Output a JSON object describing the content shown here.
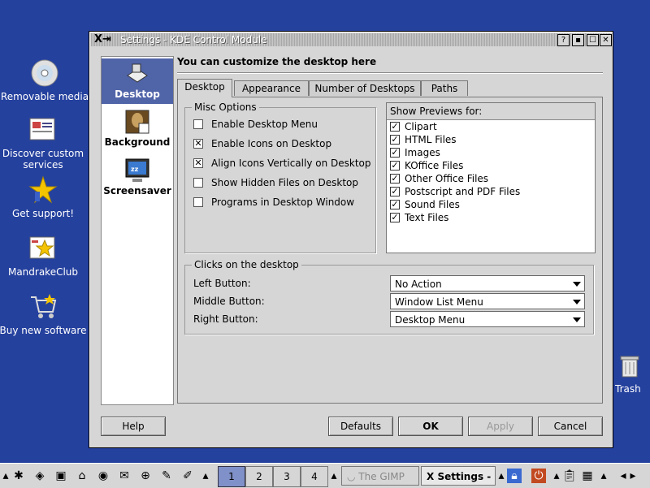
{
  "desktop": {
    "icons": [
      {
        "label": "Removable media",
        "icon": "cd-icon"
      },
      {
        "label": "Discover custom services",
        "icon": "services-icon"
      },
      {
        "label": "Get support!",
        "icon": "star-icon"
      },
      {
        "label": "MandrakeClub",
        "icon": "club-icon"
      },
      {
        "label": "Buy new software",
        "icon": "cart-icon"
      },
      {
        "label": "Trash",
        "icon": "trash-icon"
      }
    ]
  },
  "window": {
    "title": "Settings - KDE Control Module",
    "title_buttons": [
      "?",
      "▪",
      "☐",
      "✕"
    ],
    "heading": "You can customize the desktop here",
    "sidebar": [
      {
        "label": "Desktop",
        "icon": "desktop-icon",
        "active": true
      },
      {
        "label": "Background",
        "icon": "background-icon",
        "active": false
      },
      {
        "label": "Screensaver",
        "icon": "screensaver-icon",
        "active": false
      }
    ],
    "tabs": [
      {
        "label": "Desktop",
        "active": true
      },
      {
        "label": "Appearance",
        "active": false
      },
      {
        "label": "Number of Desktops",
        "active": false
      },
      {
        "label": "Paths",
        "active": false
      }
    ],
    "misc_options": {
      "title": "Misc Options",
      "items": [
        {
          "label": "Enable Desktop Menu",
          "checked": false
        },
        {
          "label": "Enable Icons on Desktop",
          "checked": true
        },
        {
          "label": "Align Icons Vertically on Desktop",
          "checked": true
        },
        {
          "label": "Show Hidden Files on Desktop",
          "checked": false
        },
        {
          "label": "Programs in Desktop Window",
          "checked": false
        }
      ]
    },
    "previews": {
      "header": "Show Previews for:",
      "items": [
        {
          "label": "Clipart",
          "checked": true
        },
        {
          "label": "HTML Files",
          "checked": true
        },
        {
          "label": "Images",
          "checked": true
        },
        {
          "label": "KOffice Files",
          "checked": true
        },
        {
          "label": "Other Office Files",
          "checked": true
        },
        {
          "label": "Postscript and PDF Files",
          "checked": true
        },
        {
          "label": "Sound Files",
          "checked": true
        },
        {
          "label": "Text Files",
          "checked": true
        }
      ]
    },
    "clicks": {
      "title": "Clicks on the desktop",
      "rows": [
        {
          "label": "Left Button:",
          "value": "No Action"
        },
        {
          "label": "Middle Button:",
          "value": "Window List Menu"
        },
        {
          "label": "Right Button:",
          "value": "Desktop Menu"
        }
      ]
    },
    "buttons": {
      "help": "Help",
      "defaults": "Defaults",
      "ok": "OK",
      "apply": "Apply",
      "cancel": "Cancel"
    }
  },
  "taskbar": {
    "desktops": [
      "1",
      "2",
      "3",
      "4"
    ],
    "tasks": [
      {
        "label": "The GIMP",
        "active": false
      },
      {
        "label": "Settings -",
        "active": true
      }
    ]
  }
}
